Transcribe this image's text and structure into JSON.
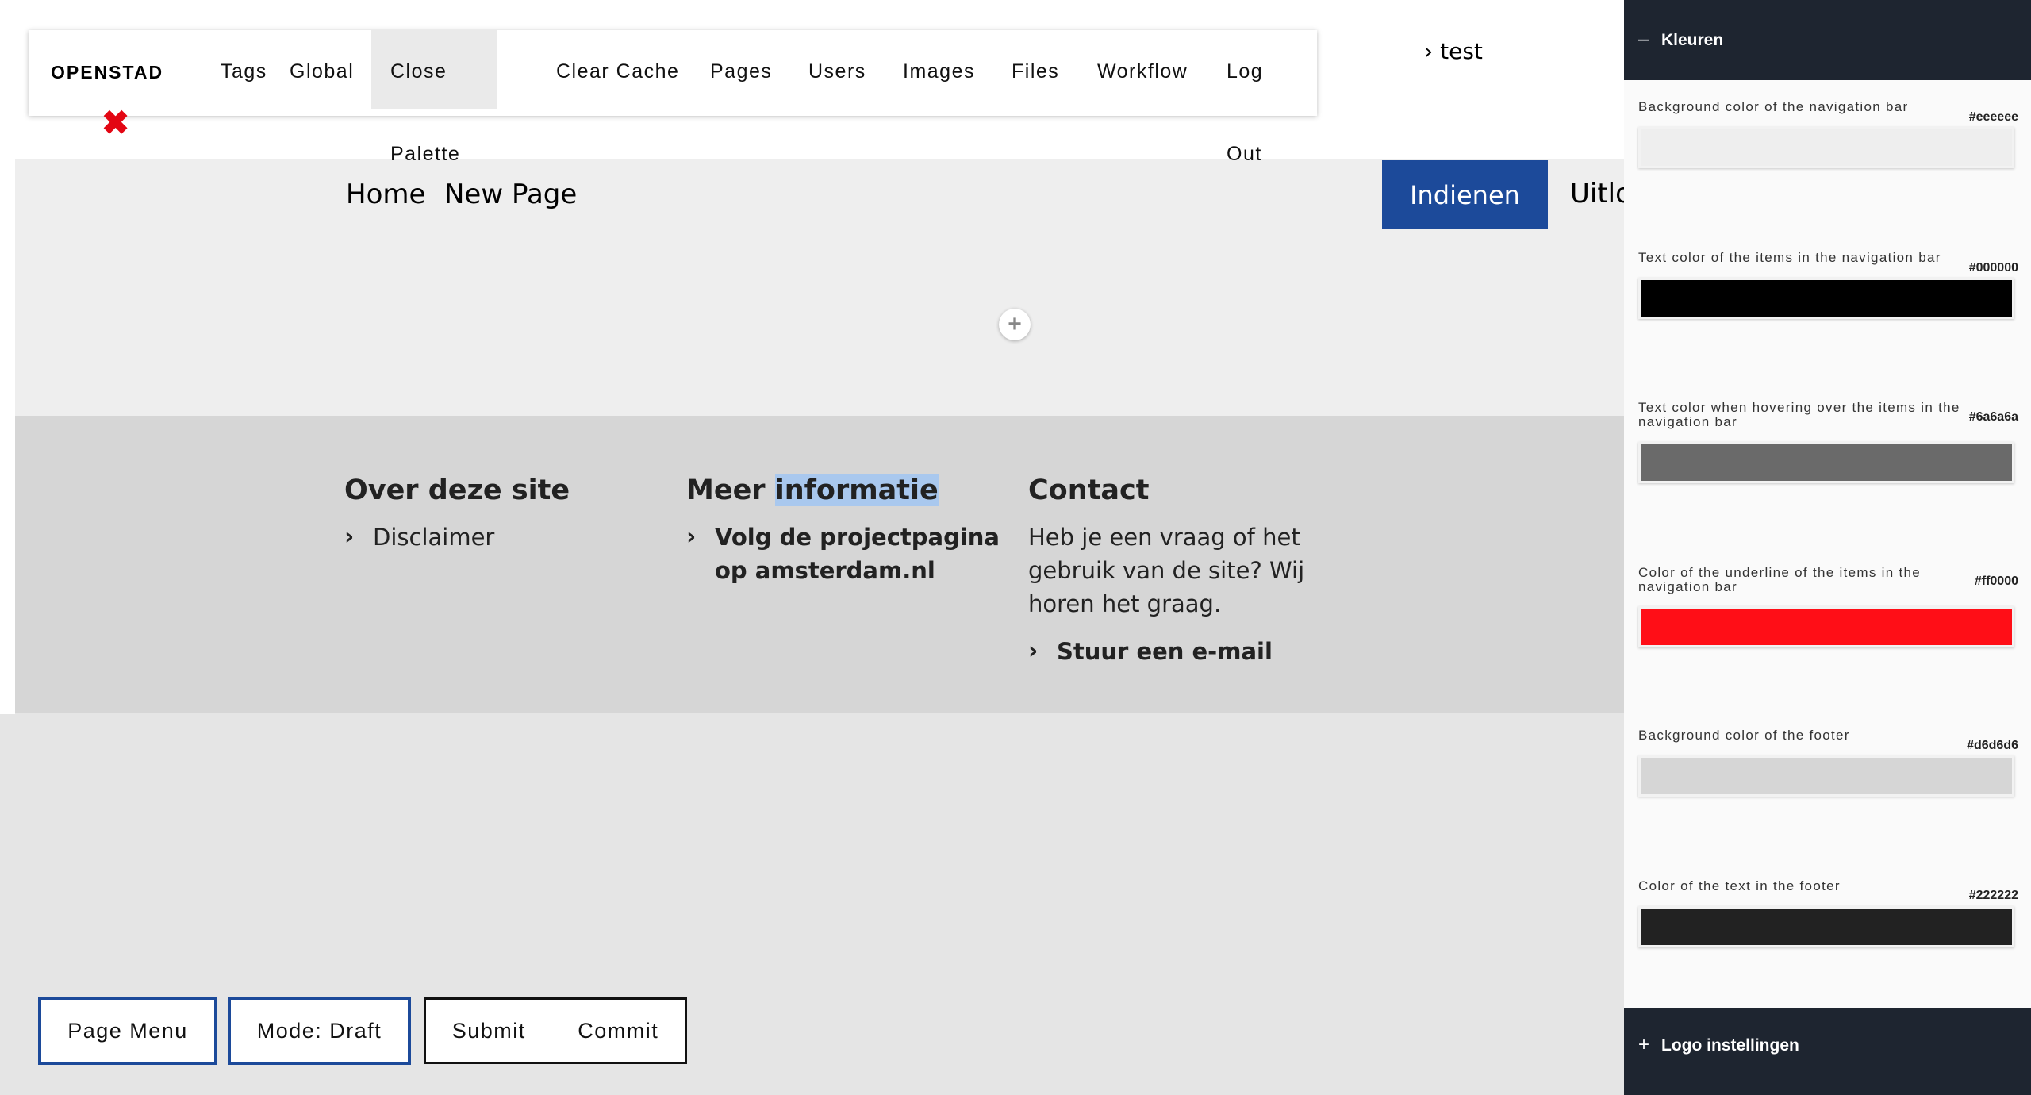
{
  "admin_bar": {
    "brand": "OPENSTAD",
    "items": [
      "Tags",
      "Global",
      "Close Palette",
      "Clear Cache",
      "Pages",
      "Users",
      "Images",
      "Files",
      "Workflow",
      "Log Out"
    ],
    "close_icon": "close-x-icon",
    "test_link": "test"
  },
  "site_nav": {
    "links": [
      "Home",
      "New Page"
    ],
    "cta": "Indienen",
    "right_link": "Uitlo"
  },
  "add_block": "+",
  "footer": {
    "col1": {
      "title": "Over deze site",
      "links": [
        "Disclaimer"
      ]
    },
    "col2": {
      "title_a": "Meer ",
      "title_b": "informatie",
      "link": "Volg de projectpagina op amsterdam.nl"
    },
    "col3": {
      "title": "Contact",
      "text": "Heb je een vraag of het gebruik van de site? Wij horen het graag.",
      "link": "Stuur een e-mail"
    },
    "chevron": "›"
  },
  "controls": {
    "page_menu": "Page Menu",
    "mode": "Mode: Draft",
    "submit": "Submit",
    "commit": "Commit"
  },
  "palette": {
    "section_open": {
      "symbol": "–",
      "title": "Kleuren"
    },
    "fields": [
      {
        "label": "Background color of the navigation bar",
        "value": "#eeeeee",
        "color": "#eeeeee"
      },
      {
        "label": "Text color of the items in the navigation bar",
        "value": "#000000",
        "color": "#000000"
      },
      {
        "label": "Text color when hovering over the items in the navigation bar",
        "value": "#6a6a6a",
        "color": "#6a6a6a"
      },
      {
        "label": "Color of the underline of the items in the navigation bar",
        "value": "#ff0000",
        "color": "#ff0e17"
      },
      {
        "label": "Background color of the footer",
        "value": "#d6d6d6",
        "color": "#d6d6d6"
      },
      {
        "label": "Color of the text in the footer",
        "value": "#222222",
        "color": "#222222"
      }
    ],
    "section_closed": {
      "symbol": "+",
      "title": "Logo instellingen"
    }
  },
  "colors": {
    "accent_blue": "#1c4a9a",
    "palette_dark": "#1e2530",
    "close_red": "#e30613"
  }
}
